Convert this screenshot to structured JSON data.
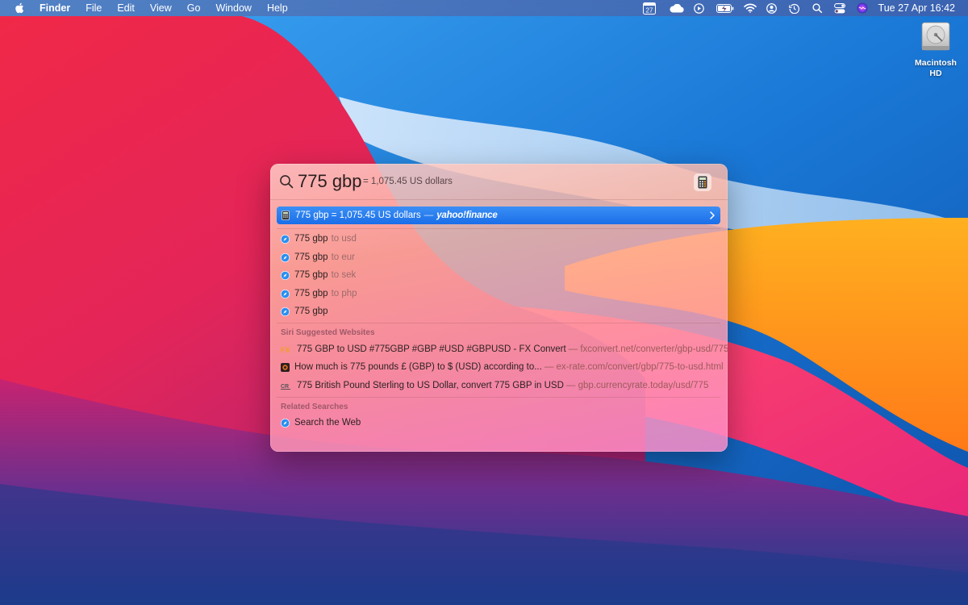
{
  "menubar": {
    "app_name": "Finder",
    "menus": [
      "File",
      "Edit",
      "View",
      "Go",
      "Window",
      "Help"
    ],
    "calendar_day": "27",
    "clock": "Tue 27 Apr  16:42",
    "status_icons": [
      "calendar-icon",
      "icloud-icon",
      "play-icon",
      "battery-icon",
      "wifi-icon",
      "user-icon",
      "time-machine-icon",
      "spotlight-icon",
      "control-center-icon",
      "siri-icon"
    ]
  },
  "desktop": {
    "drive_label": "Macintosh HD"
  },
  "spotlight": {
    "query": "775 gbp",
    "inline_result": "= 1,075.45 US dollars",
    "top_hit": {
      "text": "775 gbp = 1,075.45 US dollars",
      "dash": "—",
      "source": "yahoo!finance"
    },
    "suggestions": [
      {
        "query": "775 gbp",
        "suffix": "to usd"
      },
      {
        "query": "775 gbp",
        "suffix": "to eur"
      },
      {
        "query": "775 gbp",
        "suffix": "to sek"
      },
      {
        "query": "775 gbp",
        "suffix": "to php"
      },
      {
        "query": "775 gbp",
        "suffix": ""
      }
    ],
    "siri_section_title": "Siri Suggested Websites",
    "websites": [
      {
        "title": "775 GBP to USD #775GBP #GBP #USD #GBPUSD - FX Convert",
        "url": "— fxconvert.net/converter/gbp-usd/775",
        "icon": "FX"
      },
      {
        "title": "How much is 775 pounds £ (GBP) to $ (USD) according to...",
        "url": "— ex-rate.com/convert/gbp/775-to-usd.html",
        "icon": ""
      },
      {
        "title": "775 British Pound Sterling to US Dollar, convert 775 GBP in USD",
        "url": "— gbp.currencyrate.today/usd/775",
        "icon": "CR"
      }
    ],
    "related_section_title": "Related Searches",
    "search_web": "Search the Web"
  },
  "colors": {
    "accent": "#1a6ee8",
    "section_heading": "#a0586a"
  }
}
